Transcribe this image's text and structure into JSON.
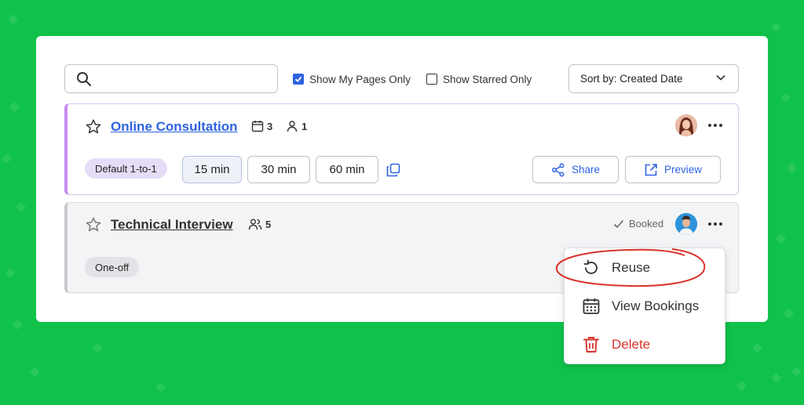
{
  "toolbar": {
    "search": {
      "placeholder": "",
      "value": ""
    },
    "filters": [
      {
        "label": "Show My Pages Only",
        "checked": true
      },
      {
        "label": "Show Starred Only",
        "checked": false
      }
    ],
    "sort": {
      "label": "Sort by: Created Date"
    }
  },
  "pages": [
    {
      "title": "Online Consultation",
      "event_count": "3",
      "host_count": "1",
      "type": "Default 1-to-1",
      "durations": [
        "15 min",
        "30 min",
        "60 min"
      ],
      "selected_duration": "15 min",
      "actions": {
        "share": "Share",
        "preview": "Preview"
      }
    },
    {
      "title": "Technical Interview",
      "guest_count": "5",
      "type": "One-off",
      "status": "Booked"
    }
  ],
  "menu": {
    "items": [
      {
        "label": "Reuse",
        "icon": "reuse-icon",
        "highlighted": true
      },
      {
        "label": "View Bookings",
        "icon": "calendar-icon"
      },
      {
        "label": "Delete",
        "icon": "trash-icon",
        "destructive": true
      }
    ]
  },
  "colors": {
    "background": "#10c24a",
    "accent": "#2f63e0",
    "card1_border": "#c58bf0",
    "danger": "#d9342b",
    "annotation": "#d9342b"
  }
}
